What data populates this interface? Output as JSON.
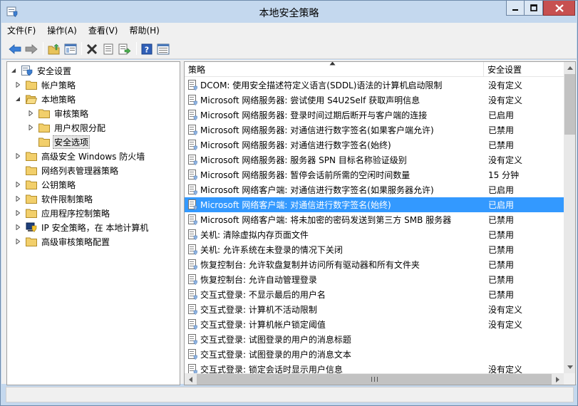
{
  "window": {
    "title": "本地安全策略"
  },
  "menu": {
    "items": [
      {
        "label": "文件(F)"
      },
      {
        "label": "操作(A)"
      },
      {
        "label": "查看(V)"
      },
      {
        "label": "帮助(H)"
      }
    ]
  },
  "toolbar": {
    "buttons": [
      "back-arrow-icon",
      "forward-arrow-icon",
      "up-folder-icon",
      "show-hide-tree-icon",
      "delete-icon",
      "properties-icon",
      "export-list-icon",
      "help-icon",
      "console-view-icon"
    ]
  },
  "tree": {
    "items": [
      {
        "label": "安全设置",
        "expanded": true
      },
      {
        "label": "帐户策略",
        "expanded": false
      },
      {
        "label": "本地策略",
        "expanded": true
      },
      {
        "label": "审核策略",
        "expanded": false
      },
      {
        "label": "用户权限分配",
        "expanded": false
      },
      {
        "label": "安全选项",
        "selected": true
      },
      {
        "label": "高级安全 Windows 防火墙",
        "expanded": false
      },
      {
        "label": "网络列表管理器策略"
      },
      {
        "label": "公钥策略",
        "expanded": false
      },
      {
        "label": "软件限制策略",
        "expanded": false
      },
      {
        "label": "应用程序控制策略",
        "expanded": false
      },
      {
        "label": "IP 安全策略，在 本地计算机",
        "expanded": false
      },
      {
        "label": "高级审核策略配置",
        "expanded": false
      }
    ]
  },
  "list": {
    "columns": {
      "policy": "策略",
      "setting": "安全设置"
    },
    "rows": [
      {
        "policy": "DCOM: 使用安全描述符定义语言(SDDL)语法的计算机启动限制",
        "setting": "没有定义"
      },
      {
        "policy": "Microsoft 网络服务器: 尝试使用 S4U2Self 获取声明信息",
        "setting": "没有定义"
      },
      {
        "policy": "Microsoft 网络服务器: 登录时间过期后断开与客户端的连接",
        "setting": "已启用"
      },
      {
        "policy": "Microsoft 网络服务器: 对通信进行数字签名(如果客户端允许)",
        "setting": "已禁用"
      },
      {
        "policy": "Microsoft 网络服务器: 对通信进行数字签名(始终)",
        "setting": "已禁用"
      },
      {
        "policy": "Microsoft 网络服务器: 服务器 SPN 目标名称验证级别",
        "setting": "没有定义"
      },
      {
        "policy": "Microsoft 网络服务器: 暂停会话前所需的空闲时间数量",
        "setting": "15 分钟"
      },
      {
        "policy": "Microsoft 网络客户端: 对通信进行数字签名(如果服务器允许)",
        "setting": "已启用"
      },
      {
        "policy": "Microsoft 网络客户端: 对通信进行数字签名(始终)",
        "setting": "已启用",
        "selected": true
      },
      {
        "policy": "Microsoft 网络客户端: 将未加密的密码发送到第三方 SMB 服务器",
        "setting": "已禁用"
      },
      {
        "policy": "关机: 清除虚拟内存页面文件",
        "setting": "已禁用"
      },
      {
        "policy": "关机: 允许系统在未登录的情况下关闭",
        "setting": "已禁用"
      },
      {
        "policy": "恢复控制台: 允许软盘复制并访问所有驱动器和所有文件夹",
        "setting": "已禁用"
      },
      {
        "policy": "恢复控制台: 允许自动管理登录",
        "setting": "已禁用"
      },
      {
        "policy": "交互式登录: 不显示最后的用户名",
        "setting": "已禁用"
      },
      {
        "policy": "交互式登录: 计算机不活动限制",
        "setting": "没有定义"
      },
      {
        "policy": "交互式登录: 计算机帐户锁定阈值",
        "setting": "没有定义"
      },
      {
        "policy": "交互式登录: 试图登录的用户的消息标题",
        "setting": ""
      },
      {
        "policy": "交互式登录: 试图登录的用户的消息文本",
        "setting": ""
      },
      {
        "policy": "交互式登录: 锁定会话时显示用户信息",
        "setting": "没有定义"
      }
    ]
  },
  "colors": {
    "selection": "#3399ff",
    "frame": "#c4d8ee",
    "close_button": "#c75050"
  }
}
